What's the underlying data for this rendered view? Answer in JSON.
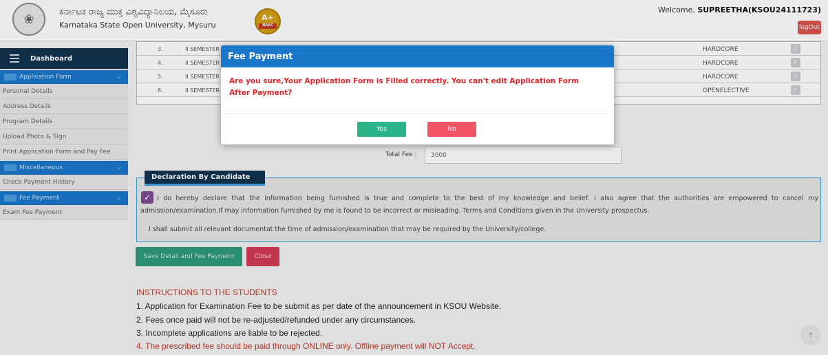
{
  "header": {
    "university_name_kn": "ಕರ್ನಾಟಕ ರಾಜ್ಯ ಮುಕ್ತ ವಿಶ್ವವಿದ್ಯಾನಿಲಯ, ಮೈಸೂರು",
    "university_name_en": "Karnataka State Open University, Mysuru",
    "naac_grade": "A+",
    "naac_label": "NAAC",
    "welcome_prefix": "Welcome, ",
    "welcome_user": "SUPREETHA(KSOU24111723)",
    "logout_label": "logOut"
  },
  "sidebar": {
    "dashboard_label": "Dashboard",
    "sections": [
      {
        "label": "Application Form",
        "items": [
          "Personal Details",
          "Address Details",
          "Program Details",
          "Upload Photo & Sign",
          "Print Application Form and Pay Fee"
        ]
      },
      {
        "label": "Miscellaneous",
        "items": [
          "Check Payment History"
        ]
      },
      {
        "label": "Fee Payment",
        "items": [
          "Exam Fee Payment"
        ]
      }
    ]
  },
  "table": {
    "rows": [
      {
        "sn": "3.",
        "semester": "II SEMESTER",
        "type": "HARDCORE"
      },
      {
        "sn": "4.",
        "semester": "II SEMESTER",
        "type": "HARDCORE"
      },
      {
        "sn": "5.",
        "semester": "II SEMESTER",
        "type": "HARDCORE"
      },
      {
        "sn": "6.",
        "semester": "II SEMESTER",
        "type": "OPENELECTIVE"
      }
    ]
  },
  "fee": {
    "total_label": "Total Fee :",
    "total_value": "3000"
  },
  "declaration": {
    "title": "Declaration By Candidate",
    "text1": "I do hereby declare that the information being furnished is true and complete to the best of my knowledge and belief. I also agree that the authorities are empowered to cancel my admission/examination.If may information furnished by me is found to be incorrect or misleading. Terms and Conditions given in the University prospectus.",
    "text2": "I shall submit all relevant documentat the time of admission/examination that may be required by the University/college."
  },
  "actions": {
    "save_label": "Save Detail and Fee Payment",
    "close_label": "Close"
  },
  "instructions": {
    "title": "INSTRUCTIONS TO THE STUDENTS",
    "items": [
      "1. Application for Examination Fee to be submit as per date of the announcement in KSOU Website.",
      "2. Fees once paid will not be re-adjusted/refunded under any circumstances.",
      "3. Incomplete applications are liable to be rejected.",
      "4. The prescribed fee should be paid through ONLINE only. Offline payment will NOT Accept."
    ]
  },
  "modal": {
    "title": "Fee Payment",
    "message": "Are you sure,Your Application Form is Filled correctly. You can't edit Application Form After Payment?",
    "yes_label": "Yes",
    "no_label": "No"
  },
  "colors": {
    "primary_blue": "#1a77c9",
    "dark_navy": "#12324f",
    "danger_red": "#e0242b",
    "success_green": "#2cb38a"
  }
}
